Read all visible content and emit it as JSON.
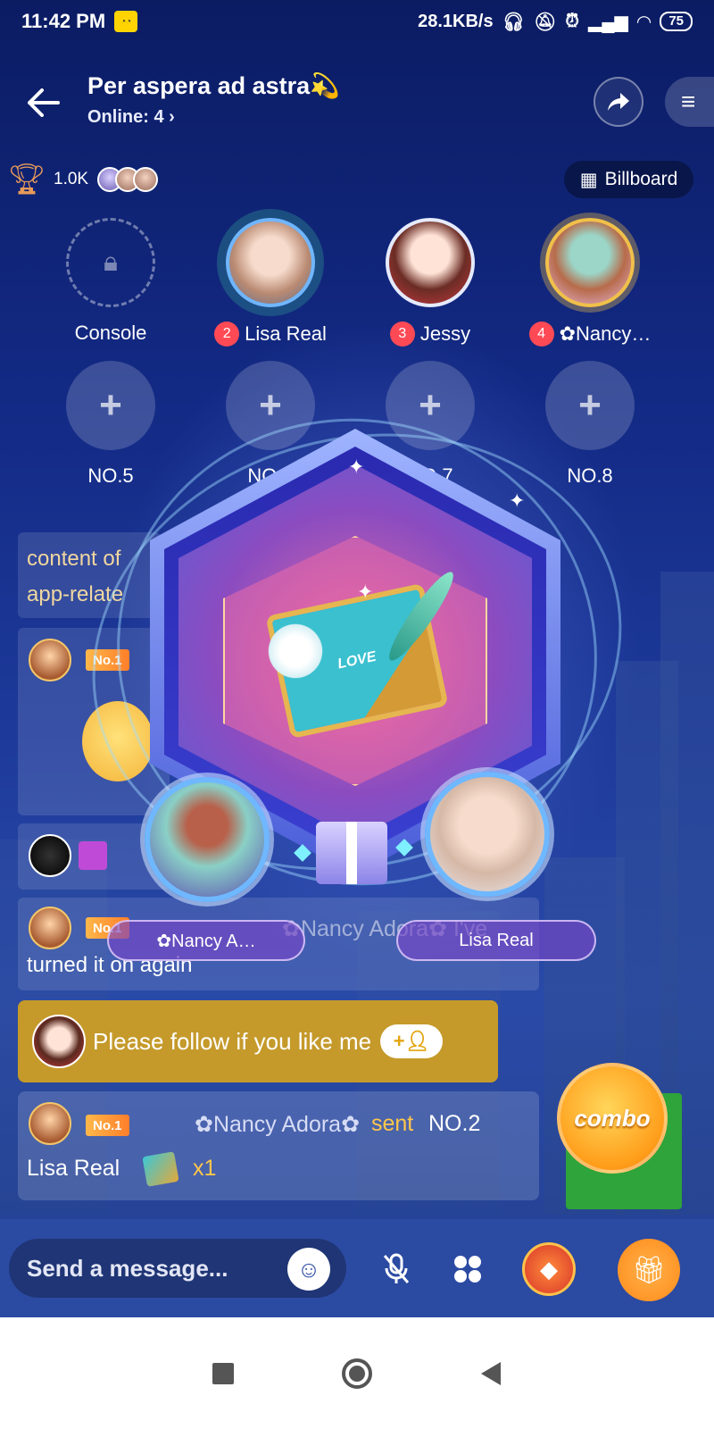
{
  "status_bar": {
    "time": "11:42 PM",
    "speed": "28.1KB/s",
    "battery": "75"
  },
  "header": {
    "room_title": "Per aspera ad astra💫",
    "online": "Online: 4 ›"
  },
  "ranking": {
    "count": "1.0K",
    "billboard_label": "Billboard"
  },
  "seats": [
    {
      "label": "Console",
      "num": ""
    },
    {
      "label": "Lisa Real",
      "num": "2"
    },
    {
      "label": "Jessy",
      "num": "3"
    },
    {
      "label": "✿Nancy…",
      "num": "4"
    },
    {
      "label": "NO.5",
      "num": ""
    },
    {
      "label": "NO.6",
      "num": ""
    },
    {
      "label": "NO.7",
      "num": ""
    },
    {
      "label": "NO.8",
      "num": ""
    }
  ],
  "chat": {
    "msg_a_line1": "content of",
    "msg_a_line2": "app-relate",
    "badge_no1": "No.1",
    "msg_d_ghost": "✿Nancy Adora✿ I've",
    "msg_d_text": "turned it on again",
    "follow_text": "Please follow if you like me",
    "gift_sender": "✿Nancy Adora✿",
    "gift_sent": "sent",
    "gift_target": "NO.2",
    "gift_receiver": "Lisa Real",
    "gift_qty": "x1"
  },
  "gift_overlay": {
    "book_text": "LOVE",
    "sender_name": "✿Nancy A…",
    "receiver_name": "Lisa Real"
  },
  "combo_label": "combo",
  "bottom_bar": {
    "message_placeholder": "Send a message..."
  },
  "colors": {
    "accent_gold": "#c59a2b",
    "badge_red": "#ff4a55",
    "highlight_yellow": "#ffc74a"
  }
}
